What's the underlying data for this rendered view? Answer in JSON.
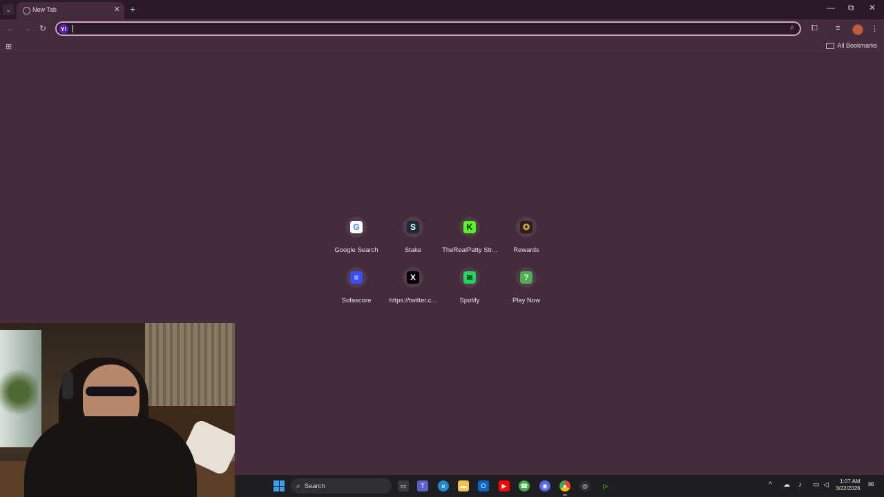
{
  "browser": {
    "tab": {
      "title": "New Tab"
    },
    "address_bar": {
      "value": ""
    },
    "bookmarks_bar": {
      "all_bookmarks_label": "All Bookmarks"
    }
  },
  "shortcuts": [
    {
      "label": "Google Search",
      "icon": "google-icon",
      "glyph": "G",
      "color": "#4285f4",
      "bg": "#ffffff"
    },
    {
      "label": "Stake",
      "icon": "stake-icon",
      "glyph": "S",
      "color": "#ffffff",
      "bg": "#1a2c38"
    },
    {
      "label": "TheRealPatty Str...",
      "icon": "kick-icon",
      "glyph": "K",
      "color": "#0b0b0b",
      "bg": "#53fc18"
    },
    {
      "label": "Rewards",
      "icon": "rewards-icon",
      "glyph": "✪",
      "color": "#d9a441",
      "bg": "#2a2218"
    },
    {
      "label": "Sofascore",
      "icon": "sofascore-icon",
      "glyph": "≡",
      "color": "#ffffff",
      "bg": "#374df5"
    },
    {
      "label": "https://twitter.c...",
      "icon": "x-twitter-icon",
      "glyph": "X",
      "color": "#ffffff",
      "bg": "#000000"
    },
    {
      "label": "Spotify",
      "icon": "spotify-icon",
      "glyph": "≋",
      "color": "#111111",
      "bg": "#1ed760"
    },
    {
      "label": "Play Now",
      "icon": "play-now-icon",
      "glyph": "?",
      "color": "#ffffff",
      "bg": "#4caf50"
    }
  ],
  "taskbar": {
    "search_label": "Search",
    "clock": {
      "time": "1:07 AM",
      "date": "3/22/2026"
    }
  }
}
